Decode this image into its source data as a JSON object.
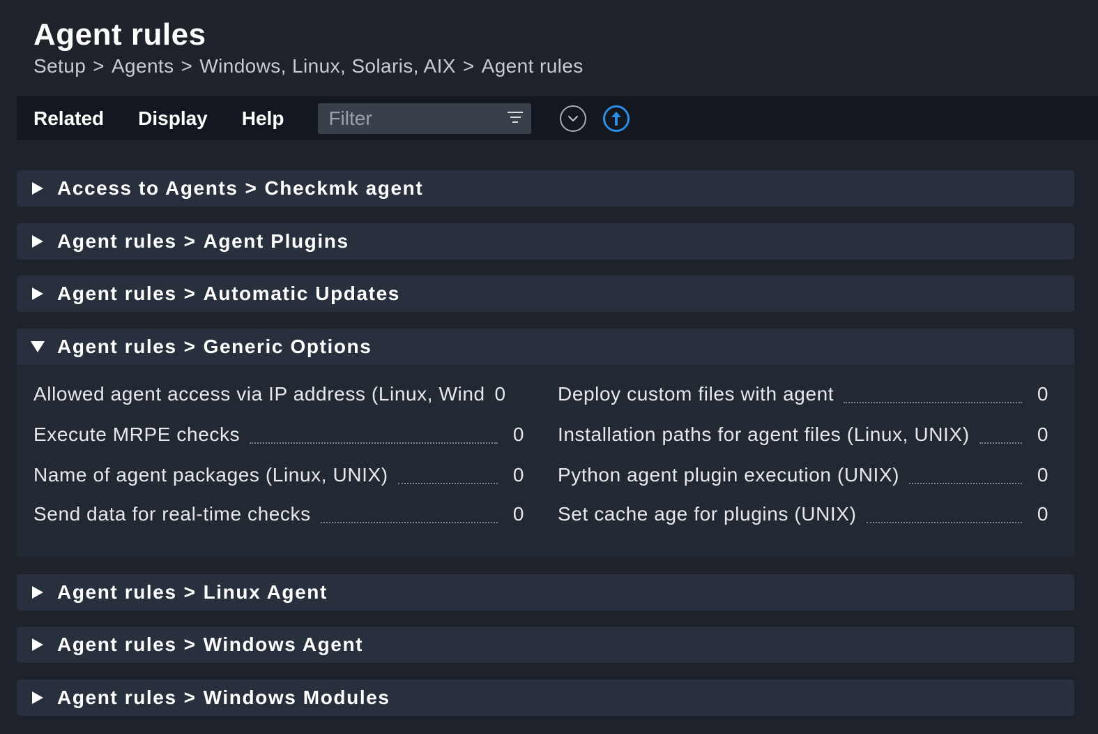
{
  "page": {
    "title": "Agent rules",
    "breadcrumb": [
      "Setup",
      "Agents",
      "Windows, Linux, Solaris, AIX",
      "Agent rules"
    ],
    "breadcrumb_separator": ">"
  },
  "menubar": {
    "related": "Related",
    "display": "Display",
    "help": "Help",
    "filter_placeholder": "Filter",
    "icons": [
      "filter-icon",
      "collapse-all-icon",
      "upload-icon"
    ]
  },
  "sections": [
    {
      "left": "Access to Agents",
      "right": "Checkmk agent",
      "open": false
    },
    {
      "left": "Agent rules",
      "right": "Agent Plugins",
      "open": false
    },
    {
      "left": "Agent rules",
      "right": "Automatic Updates",
      "open": false
    },
    {
      "left": "Agent rules",
      "right": "Generic Options",
      "open": true
    },
    {
      "left": "Agent rules",
      "right": "Linux Agent",
      "open": false
    },
    {
      "left": "Agent rules",
      "right": "Windows Agent",
      "open": false
    },
    {
      "left": "Agent rules",
      "right": "Windows Modules",
      "open": false
    }
  ],
  "generic_options_rules": [
    {
      "name": "Allowed agent access via IP address (Linux, Wind",
      "count": "0"
    },
    {
      "name": "Deploy custom files with agent",
      "count": "0"
    },
    {
      "name": "Execute MRPE checks",
      "count": "0"
    },
    {
      "name": "Installation paths for agent files (Linux, UNIX)",
      "count": "0"
    },
    {
      "name": "Name of agent packages (Linux, UNIX)",
      "count": "0"
    },
    {
      "name": "Python agent plugin execution (UNIX)",
      "count": "0"
    },
    {
      "name": "Send data for real-time checks",
      "count": "0"
    },
    {
      "name": "Set cache age for plugins (UNIX)",
      "count": "0"
    }
  ],
  "colors": {
    "background": "#1e232b",
    "menubar": "#131820",
    "section": "#27303c",
    "accent": "#2d8ee6"
  }
}
